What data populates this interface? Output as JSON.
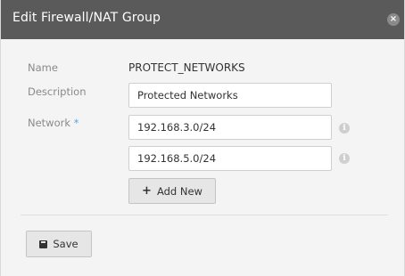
{
  "dialog": {
    "title": "Edit Firewall/NAT Group",
    "close_icon": "close-icon"
  },
  "form": {
    "name_label": "Name",
    "name_value": "PROTECT_NETWORKS",
    "description_label": "Description",
    "description_value": "Protected Networks",
    "network_label": "Network",
    "required_marker": "*",
    "networks": [
      "192.168.3.0/24",
      "192.168.5.0/24"
    ],
    "info_icon": "info-icon",
    "add_new_label": "Add New"
  },
  "footer": {
    "save_label": "Save"
  },
  "colors": {
    "titlebar": "#5a5a5a",
    "body": "#f4f4f4",
    "required": "#5aa6e0"
  }
}
